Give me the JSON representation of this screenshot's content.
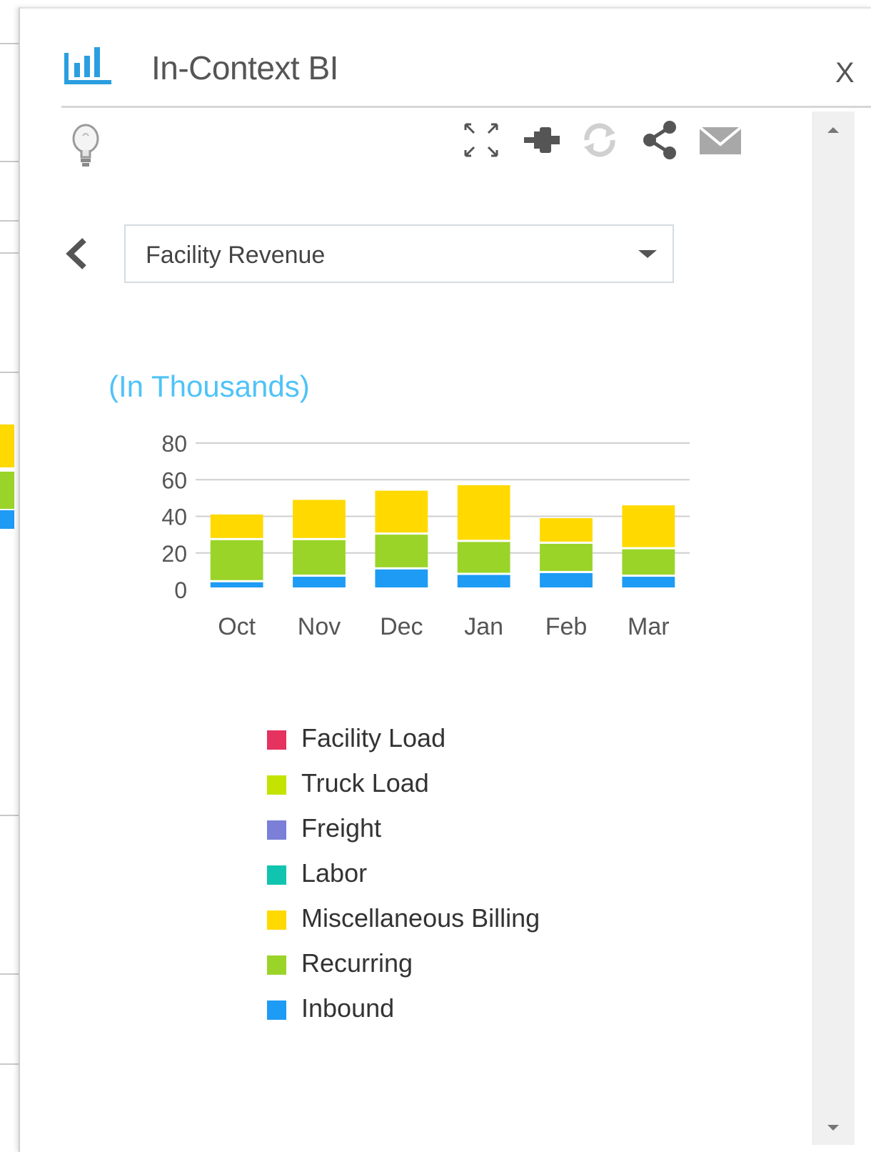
{
  "panel": {
    "title": "In-Context BI",
    "close_label": "X"
  },
  "report_selector": {
    "selected": "Facility Revenue"
  },
  "chart_data": {
    "type": "bar",
    "stacked": true,
    "unit_label": "(In Thousands)",
    "categories": [
      "Oct",
      "Nov",
      "Dec",
      "Jan",
      "Feb",
      "Mar"
    ],
    "y_ticks": [
      "80",
      "60",
      "40",
      "20",
      "0"
    ],
    "ylim": [
      0,
      80
    ],
    "grid": true,
    "legend_position": "bottom",
    "series": [
      {
        "name": "Facility Load",
        "color": "#e5325f",
        "values": [
          0,
          0,
          0,
          0,
          0,
          0
        ]
      },
      {
        "name": "Truck Load",
        "color": "#c5e300",
        "values": [
          0,
          0,
          0,
          0,
          0,
          0
        ]
      },
      {
        "name": "Freight",
        "color": "#7b7fd8",
        "values": [
          0,
          0,
          0,
          0,
          0,
          0
        ]
      },
      {
        "name": "Labor",
        "color": "#11c4b0",
        "values": [
          0,
          0,
          0,
          0,
          0,
          0
        ]
      },
      {
        "name": "Miscellaneous Billing",
        "color": "#ffd900",
        "values": [
          14,
          22,
          24,
          31,
          14,
          24
        ]
      },
      {
        "name": "Recurring",
        "color": "#9ad428",
        "values": [
          23,
          20,
          19,
          18,
          16,
          15
        ]
      },
      {
        "name": "Inbound",
        "color": "#1e9bf4",
        "values": [
          4,
          7,
          11,
          8,
          9,
          7
        ]
      }
    ]
  },
  "icons": {
    "app": "bar-chart-icon",
    "bulb": "lightbulb-icon",
    "toolbar": [
      "expand-icon",
      "pin-icon",
      "refresh-icon",
      "share-icon",
      "email-icon"
    ]
  }
}
